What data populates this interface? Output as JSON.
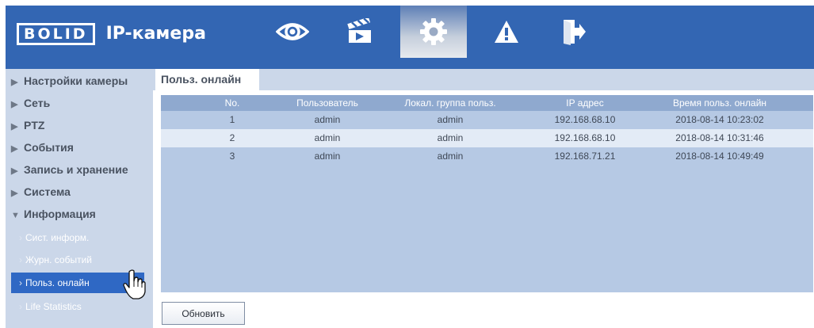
{
  "header": {
    "logo_text": "BOLID",
    "title": "IP-камера",
    "nav": [
      {
        "name": "live-view",
        "icon": "eye-icon"
      },
      {
        "name": "playback",
        "icon": "clapperboard-icon"
      },
      {
        "name": "setup",
        "icon": "gear-icon",
        "active": true
      },
      {
        "name": "alarm",
        "icon": "warning-icon"
      },
      {
        "name": "logout",
        "icon": "logout-icon"
      }
    ]
  },
  "sidebar": {
    "items": [
      {
        "label": "Настройки камеры",
        "arrow": "▶"
      },
      {
        "label": "Сеть",
        "arrow": "▶"
      },
      {
        "label": "PTZ",
        "arrow": "▶"
      },
      {
        "label": "События",
        "arrow": "▶"
      },
      {
        "label": "Запись и хранение",
        "arrow": "▶"
      },
      {
        "label": "Система",
        "arrow": "▶"
      },
      {
        "label": "Информация",
        "arrow": "▼",
        "expanded": true
      }
    ],
    "subitems": [
      {
        "label": "Сист. информ."
      },
      {
        "label": "Журн. событий"
      },
      {
        "label": "Польз. онлайн",
        "active": true
      },
      {
        "label": "Life Statistics"
      }
    ]
  },
  "main": {
    "tab_label": "Польз. онлайн",
    "table": {
      "columns": [
        "No.",
        "Пользователь",
        "Локал. группа польз.",
        "IP адрес",
        "Время польз. онлайн"
      ],
      "rows": [
        [
          "1",
          "admin",
          "admin",
          "192.168.68.10",
          "2018-08-14 10:23:02"
        ],
        [
          "2",
          "admin",
          "admin",
          "192.168.68.10",
          "2018-08-14 10:31:46"
        ],
        [
          "3",
          "admin",
          "admin",
          "192.168.71.21",
          "2018-08-14 10:49:49"
        ]
      ]
    },
    "refresh_label": "Обновить"
  },
  "colors": {
    "topbar": "#3366b3",
    "sidebar_bg": "#cbd7e9",
    "active_item": "#2f68c4",
    "table_header": "#8fa9cf",
    "table_body": "#b6c9e4",
    "row_highlight": "#e3ebf6"
  }
}
